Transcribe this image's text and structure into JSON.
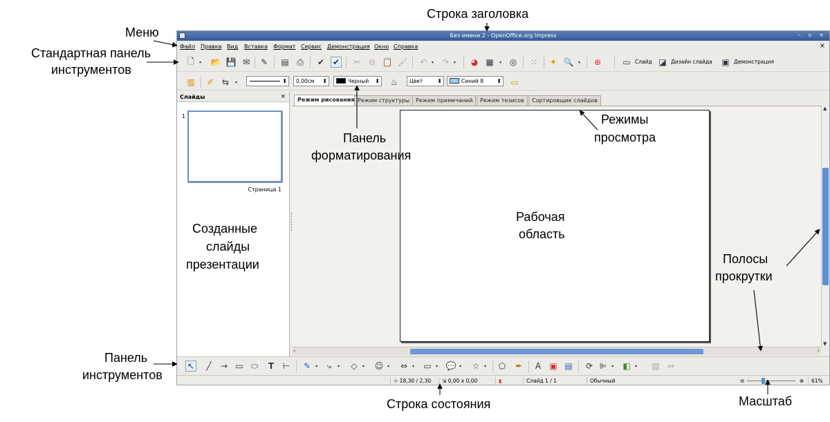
{
  "window": {
    "title": "Без имени 2 - OpenOffice.org Impress",
    "controls": "– ▫ ×",
    "menu_close": "×"
  },
  "menu": [
    {
      "label": "Файл"
    },
    {
      "label": "Правка"
    },
    {
      "label": "Вид"
    },
    {
      "label": "Вставка"
    },
    {
      "label": "Формат"
    },
    {
      "label": "Сервис"
    },
    {
      "label": "Демонстрация"
    },
    {
      "label": "Окно"
    },
    {
      "label": "Справка"
    }
  ],
  "standard_toolbar": {
    "slide_label": "Слайд",
    "slide_design_label": "Дизайн слайда",
    "presentation_label": "Демонстрация"
  },
  "format_toolbar": {
    "line_width": "0,00см",
    "line_color": "Черный",
    "line_color_hex": "#000000",
    "area_style": "Цвет",
    "area_color": "Синий 8",
    "area_color_hex": "#99ccff"
  },
  "slides_panel": {
    "title": "Слайды",
    "close": "×",
    "thumb_number": "1",
    "thumb_label": "Страница 1"
  },
  "view_tabs": [
    {
      "label": "Режим рисования",
      "active": true
    },
    {
      "label": "Режим структуры",
      "active": false
    },
    {
      "label": "Режим примечаний",
      "active": false
    },
    {
      "label": "Режим тезисов",
      "active": false
    },
    {
      "label": "Сортировщик слайдов",
      "active": false
    }
  ],
  "statusbar": {
    "position": "18,30 / 2,30",
    "size": "0,00 x 0,00",
    "slide": "Слайд 1 / 1",
    "layout": "Обычный",
    "zoom": "61%"
  },
  "annotations": {
    "title_bar": "Строка заголовка",
    "menu": "Меню",
    "standard_toolbar_1": "Стандартная панель",
    "standard_toolbar_2": "инструментов",
    "format_toolbar_1": "Панель",
    "format_toolbar_2": "форматирования",
    "view_modes_1": "Режимы",
    "view_modes_2": "просмотра",
    "slides_1": "Созданные",
    "slides_2": "слайды",
    "slides_3": "презентации",
    "work_area_1": "Рабочая",
    "work_area_2": "область",
    "scrollbars_1": "Полосы",
    "scrollbars_2": "прокрутки",
    "drawing_toolbar_1": "Панель",
    "drawing_toolbar_2": "инструментов",
    "status_bar": "Строка состояния",
    "zoom": "Масштаб"
  },
  "colors": {
    "titlebar": "#35599a",
    "scroll_thumb": "#5f8ed2",
    "selection": "#6b8fc7"
  }
}
